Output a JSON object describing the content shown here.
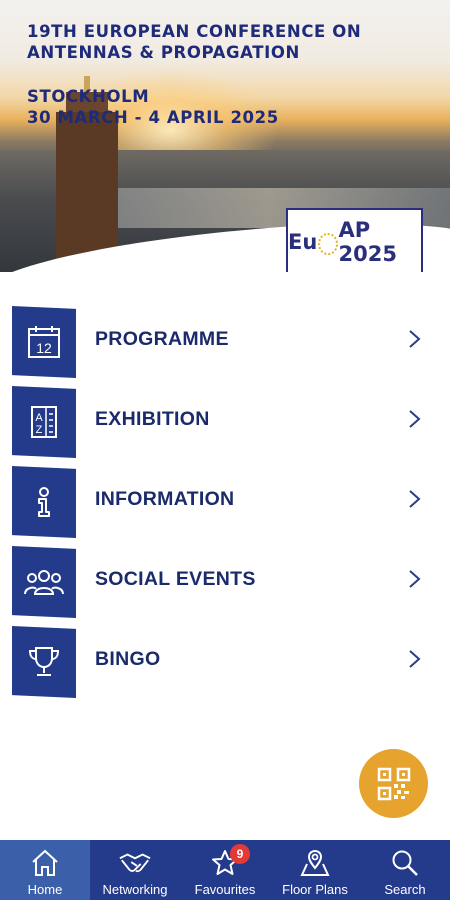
{
  "header": {
    "title_line1": "19TH EUROPEAN CONFERENCE ON",
    "title_line2": "ANTENNAS & PROPAGATION",
    "location": "STOCKHOLM",
    "dates": "30 MARCH - 4 APRIL 2025",
    "logo_text_left": "Eu",
    "logo_text_right": "AP 2025"
  },
  "menu": {
    "items": [
      {
        "label": "PROGRAMME",
        "icon": "calendar-icon",
        "icon_text": "12"
      },
      {
        "label": "EXHIBITION",
        "icon": "a-z-list-icon",
        "icon_text": "AZ"
      },
      {
        "label": "INFORMATION",
        "icon": "info-icon"
      },
      {
        "label": "SOCIAL EVENTS",
        "icon": "group-icon"
      },
      {
        "label": "BINGO",
        "icon": "trophy-icon"
      }
    ]
  },
  "fab": {
    "icon": "qr-code-icon"
  },
  "bottom_nav": {
    "items": [
      {
        "label": "Home",
        "icon": "home-icon",
        "active": true
      },
      {
        "label": "Networking",
        "icon": "handshake-icon"
      },
      {
        "label": "Favourites",
        "icon": "star-icon",
        "badge": "9"
      },
      {
        "label": "Floor Plans",
        "icon": "map-pin-icon"
      },
      {
        "label": "Search",
        "icon": "search-icon"
      }
    ]
  },
  "colors": {
    "navy": "#243a8a",
    "text_navy": "#1b2a6b",
    "active_tab": "#3b5fa8",
    "fab": "#e6a32e",
    "badge": "#e53935"
  }
}
